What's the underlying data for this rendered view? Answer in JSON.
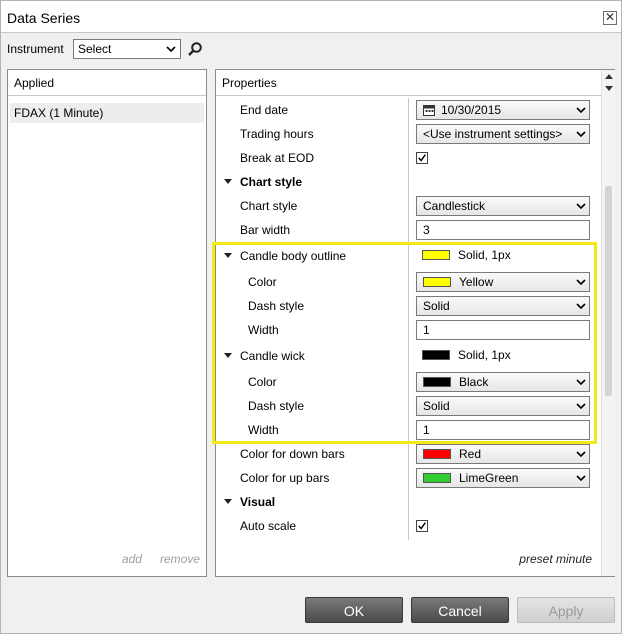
{
  "window": {
    "title": "Data Series"
  },
  "instrument": {
    "label": "Instrument",
    "select_value": "Select"
  },
  "applied": {
    "header": "Applied",
    "items": [
      "FDAX (1 Minute)"
    ],
    "add_label": "add",
    "remove_label": "remove"
  },
  "properties": {
    "header": "Properties",
    "preset_label": "preset minute",
    "rows": {
      "end_date": {
        "label": "End date",
        "value": "10/30/2015"
      },
      "trading_hours": {
        "label": "Trading hours",
        "value": "<Use instrument settings>"
      },
      "break_eod": {
        "label": "Break at EOD",
        "checked": true
      },
      "cat_chart_style": {
        "label": "Chart style"
      },
      "chart_style": {
        "label": "Chart style",
        "value": "Candlestick"
      },
      "bar_width": {
        "label": "Bar width",
        "value": "3"
      },
      "candle_body_outline": {
        "label": "Candle body outline",
        "value": "Solid, 1px",
        "swatch": "#ffff00"
      },
      "body_color": {
        "label": "Color",
        "value": "Yellow",
        "swatch": "#ffff00"
      },
      "body_dash": {
        "label": "Dash style",
        "value": "Solid"
      },
      "body_width": {
        "label": "Width",
        "value": "1"
      },
      "candle_wick": {
        "label": "Candle wick",
        "value": "Solid, 1px",
        "swatch": "#000000"
      },
      "wick_color": {
        "label": "Color",
        "value": "Black",
        "swatch": "#000000"
      },
      "wick_dash": {
        "label": "Dash style",
        "value": "Solid"
      },
      "wick_width": {
        "label": "Width",
        "value": "1"
      },
      "down_bars": {
        "label": "Color for down bars",
        "value": "Red",
        "swatch": "#ff0000"
      },
      "up_bars": {
        "label": "Color for up bars",
        "value": "LimeGreen",
        "swatch": "#32cd32"
      },
      "cat_visual": {
        "label": "Visual"
      },
      "auto_scale": {
        "label": "Auto scale",
        "checked": true
      }
    }
  },
  "buttons": {
    "ok": "OK",
    "cancel": "Cancel",
    "apply": "Apply"
  },
  "colors": {
    "highlight": "#f2ea16",
    "button_dark": "#4a4a4a"
  }
}
